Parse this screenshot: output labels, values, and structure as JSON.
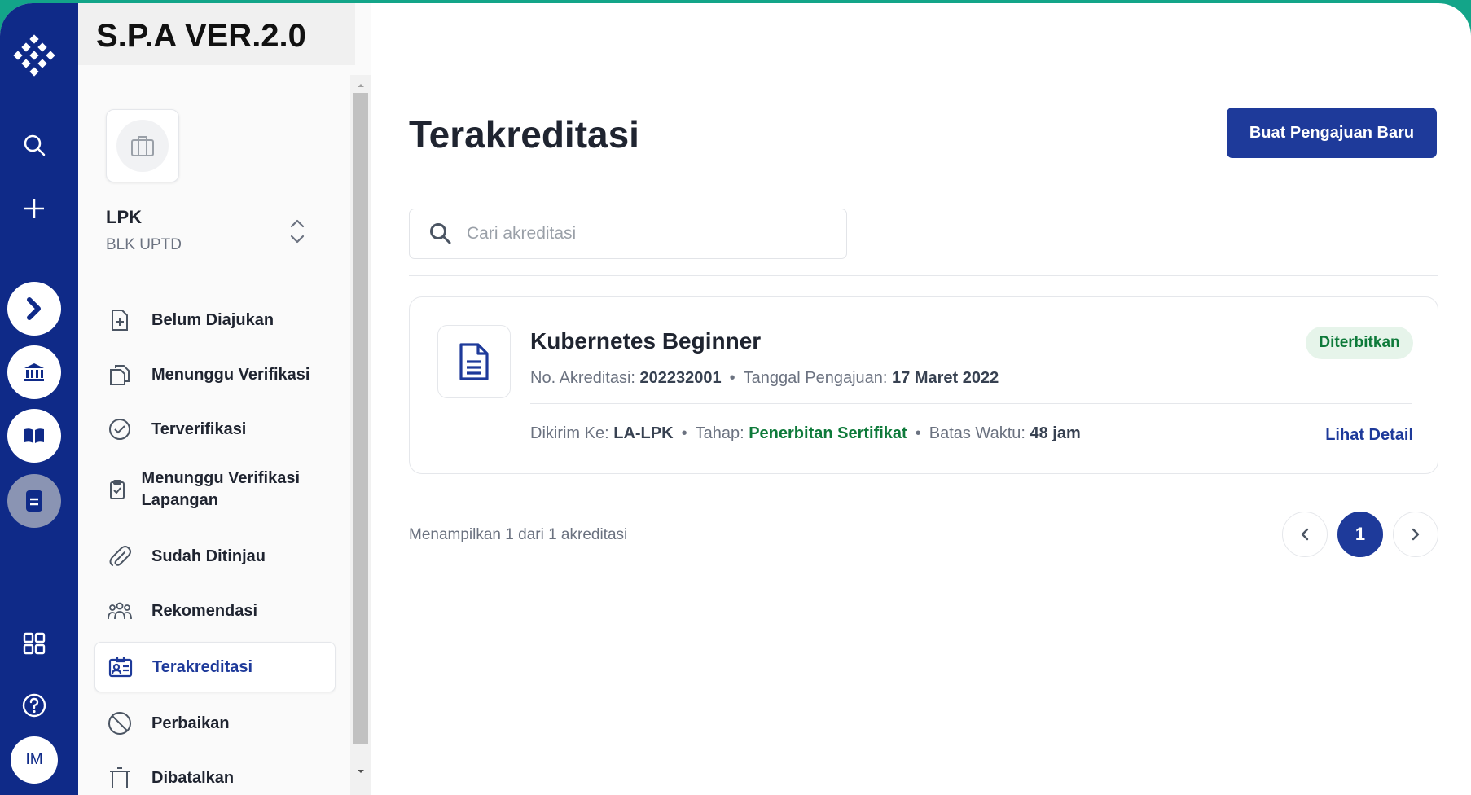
{
  "brand": {
    "title": "S.P.A VER.2.0"
  },
  "rail": {
    "icons": [
      "logo-icon",
      "search-icon",
      "plus-icon",
      "chevron-right-icon",
      "bank-icon",
      "book-icon",
      "document-icon",
      "grid-icon",
      "help-icon"
    ],
    "avatar_initials": "IM"
  },
  "org": {
    "name": "LPK",
    "sub": "BLK UPTD"
  },
  "nav": {
    "items": [
      {
        "label": "Belum Diajukan"
      },
      {
        "label": "Menunggu Verifikasi"
      },
      {
        "label": "Terverifikasi"
      },
      {
        "label": "Menunggu Verifikasi Lapangan"
      },
      {
        "label": "Sudah Ditinjau"
      },
      {
        "label": "Rekomendasi"
      },
      {
        "label": "Terakreditasi"
      },
      {
        "label": "Perbaikan"
      },
      {
        "label": "Dibatalkan"
      }
    ],
    "active": "Terakreditasi"
  },
  "main": {
    "title": "Terakreditasi",
    "new_button": "Buat Pengajuan Baru",
    "search_placeholder": "Cari akreditasi",
    "card": {
      "title": "Kubernetes Beginner",
      "status": "Diterbitkan",
      "no_label": "No. Akreditasi:",
      "no_value": "202232001",
      "date_label": "Tanggal Pengajuan:",
      "date_value": "17 Maret 2022",
      "sent_label": "Dikirim Ke:",
      "sent_value": "LA-LPK",
      "stage_label": "Tahap:",
      "stage_value": "Penerbitan Sertifikat",
      "deadline_label": "Batas Waktu:",
      "deadline_value": "48 jam",
      "detail_link": "Lihat Detail",
      "separator": "•"
    },
    "summary": "Menampilkan 1 dari 1 akreditasi",
    "pagination": {
      "current": "1"
    }
  },
  "colors": {
    "rail": "#0f2a88",
    "primary": "#1e3a9a",
    "success": "#0e7a3a",
    "success_bg": "#e6f4ea",
    "outer": "#13a589"
  }
}
